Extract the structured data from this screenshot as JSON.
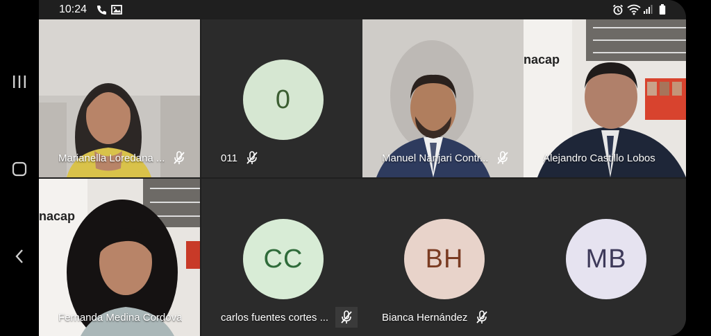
{
  "status_bar": {
    "time": "10:24",
    "icons": [
      "phone-icon",
      "gallery-icon",
      "alarm-icon",
      "wifi-icon",
      "signal-icon",
      "battery-icon"
    ]
  },
  "nav_bar": {
    "buttons": [
      "recent-apps-icon",
      "home-icon",
      "back-icon"
    ]
  },
  "participants": [
    {
      "name": "Marianella Loredana ...",
      "type": "video",
      "muted": true
    },
    {
      "name": "011",
      "type": "avatar",
      "initials": "0",
      "avatar_bg": "#d6e7d2",
      "avatar_fg": "#3c5e32",
      "muted": true
    },
    {
      "name": "Manuel Nanjari Contr...",
      "type": "video",
      "muted": true
    },
    {
      "name": "Alejandro Castillo Lobos",
      "type": "video",
      "muted": false
    },
    {
      "name": "Fernanda Medina Cordova",
      "type": "video",
      "muted": false
    },
    {
      "name": "carlos fuentes cortes ...",
      "type": "avatar",
      "initials": "CC",
      "avatar_bg": "#d8ecd6",
      "avatar_fg": "#2f6b3a",
      "muted": true
    },
    {
      "name": "Bianca Hernández",
      "type": "avatar",
      "initials": "BH",
      "avatar_bg": "#e8d3ca",
      "avatar_fg": "#7a3b22",
      "muted": true
    },
    {
      "name": "",
      "type": "avatar",
      "initials": "MB",
      "avatar_bg": "#e6e3f0",
      "avatar_fg": "#3e3a5a",
      "muted": false
    }
  ],
  "backdrop_text": "nacap"
}
